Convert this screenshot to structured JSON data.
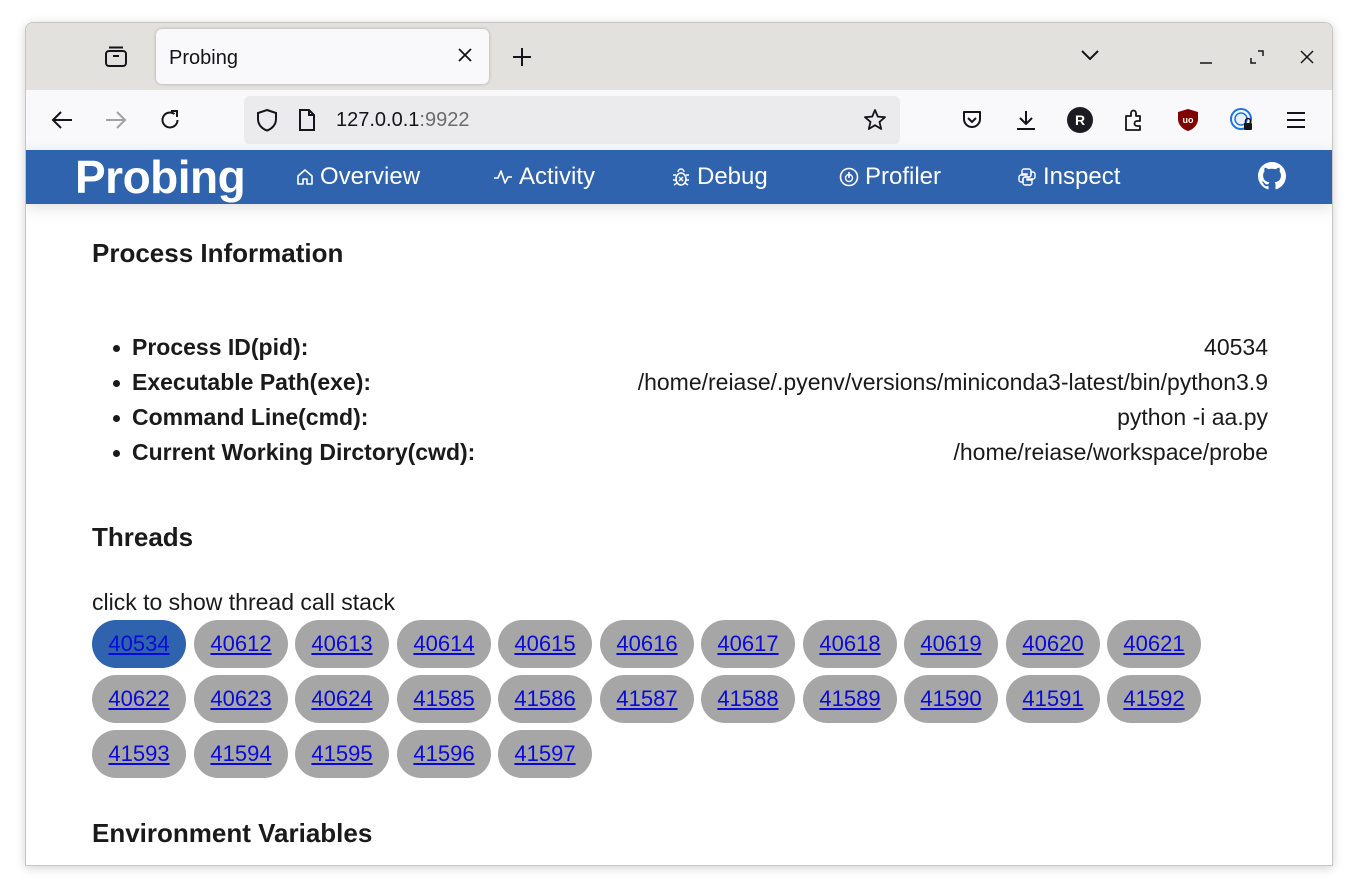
{
  "browser": {
    "tab_title": "Probing",
    "url_host": "127.0.0.1",
    "url_port": ":9922",
    "profile_initial": "R"
  },
  "site": {
    "brand": "Probing",
    "nav": [
      {
        "label": "Overview",
        "icon": "home-icon"
      },
      {
        "label": "Activity",
        "icon": "pulse-icon"
      },
      {
        "label": "Debug",
        "icon": "bug-icon"
      },
      {
        "label": "Profiler",
        "icon": "gauge-icon"
      },
      {
        "label": "Inspect",
        "icon": "python-icon"
      }
    ]
  },
  "process": {
    "heading": "Process Information",
    "items": [
      {
        "key": "Process ID(pid):",
        "value": "40534"
      },
      {
        "key": "Executable Path(exe):",
        "value": "/home/reiase/.pyenv/versions/miniconda3-latest/bin/python3.9"
      },
      {
        "key": "Command Line(cmd):",
        "value": "python -i aa.py"
      },
      {
        "key": "Current Working Dirctory(cwd):",
        "value": "/home/reiase/workspace/probe"
      }
    ]
  },
  "threads": {
    "heading": "Threads",
    "hint": "click to show thread call stack",
    "active": "40534",
    "ids": [
      "40534",
      "40612",
      "40613",
      "40614",
      "40615",
      "40616",
      "40617",
      "40618",
      "40619",
      "40620",
      "40621",
      "40622",
      "40623",
      "40624",
      "41585",
      "41586",
      "41587",
      "41588",
      "41589",
      "41590",
      "41591",
      "41592",
      "41593",
      "41594",
      "41595",
      "41596",
      "41597"
    ]
  },
  "env": {
    "heading": "Environment Variables"
  },
  "colors": {
    "header_bg": "#2f63ad",
    "pill_bg": "#a6a6a6",
    "pill_active_bg": "#2f63ad",
    "link": "#0a0ad8"
  }
}
